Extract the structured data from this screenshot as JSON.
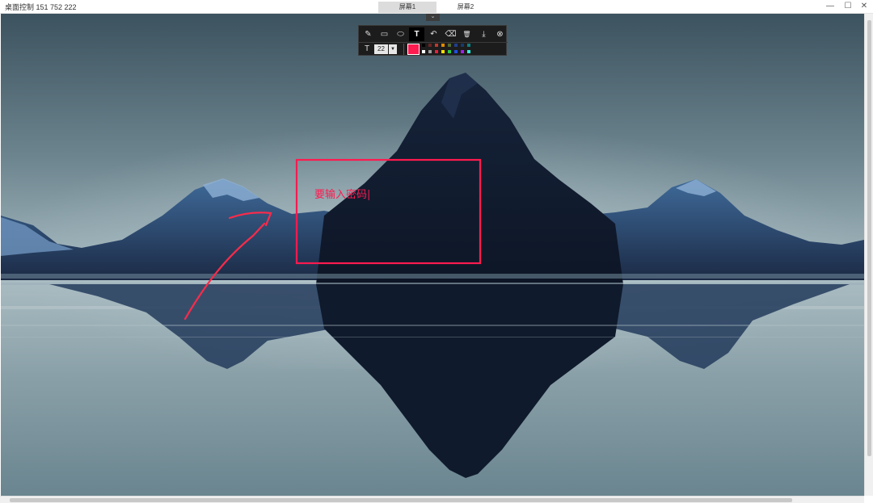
{
  "window": {
    "title": "桌面控制 151 752 222",
    "tabs": [
      {
        "label": "屏幕1",
        "active": true
      },
      {
        "label": "屏幕2",
        "active": false
      }
    ],
    "controls": {
      "minimize": "—",
      "maximize": "☐",
      "close": "✕"
    }
  },
  "toolbar": {
    "collapse_icon": "chevron-down-icon",
    "tools": [
      {
        "name": "pen",
        "icon": "pencil-icon",
        "glyph": "✎"
      },
      {
        "name": "rectangle",
        "icon": "rectangle-icon",
        "glyph": "▭"
      },
      {
        "name": "ellipse",
        "icon": "ellipse-icon",
        "glyph": "⬭"
      },
      {
        "name": "text",
        "icon": "text-tool-icon",
        "glyph": "T",
        "active": true
      },
      {
        "name": "undo",
        "icon": "undo-icon",
        "glyph": "↶"
      },
      {
        "name": "eraser",
        "icon": "eraser-icon",
        "glyph": "⌫"
      },
      {
        "name": "delete",
        "icon": "trash-icon",
        "glyph": "🗑"
      },
      {
        "name": "save",
        "icon": "download-icon",
        "glyph": "⤓"
      },
      {
        "name": "close",
        "icon": "close-circle-icon",
        "glyph": "⊗"
      }
    ],
    "text_icon": "T",
    "font_size": "22",
    "dropdown_glyph": "▼",
    "current_color": "#ff1a4f",
    "palette_row1": [
      "#000000",
      "#6b2424",
      "#c0392b",
      "#e08a00",
      "#556b2f",
      "#1f3f8f",
      "#153a6f",
      "#0f7f7f"
    ],
    "palette_row2": [
      "#ffffff",
      "#a0a0a0",
      "#e8203a",
      "#f5e000",
      "#2ecc40",
      "#2050e0",
      "#a020f0",
      "#30f0e0"
    ]
  },
  "annotation": {
    "text": "要输入密码|",
    "color": "#ff1a4f"
  }
}
